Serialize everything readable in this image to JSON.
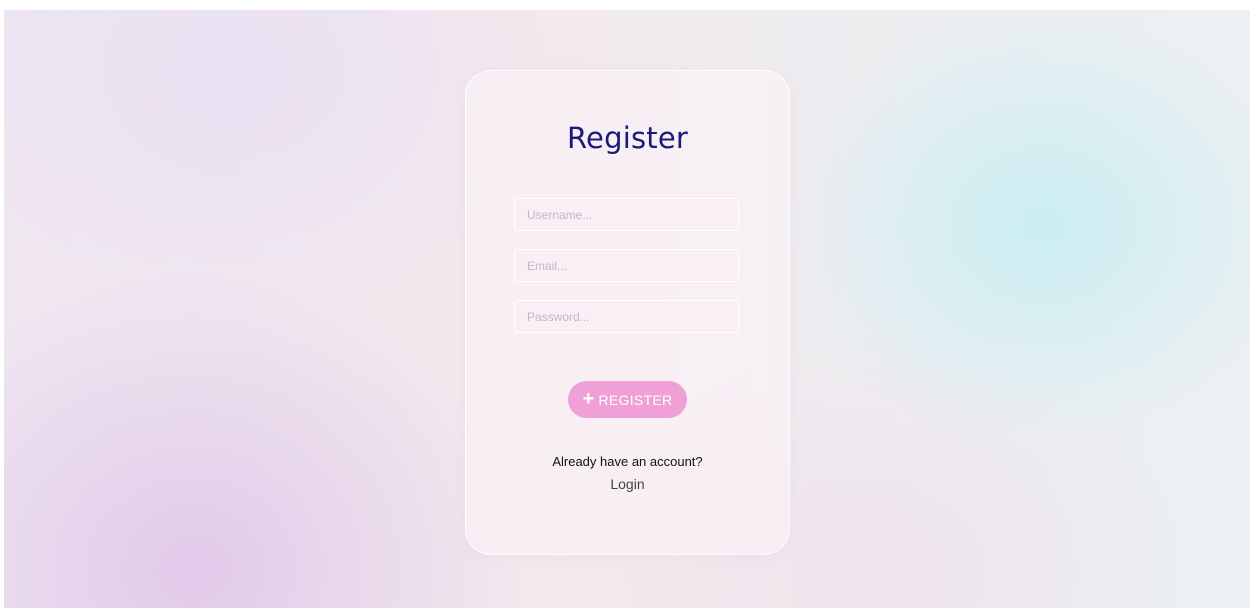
{
  "form": {
    "title": "Register",
    "username": {
      "value": "",
      "placeholder": "Username..."
    },
    "email": {
      "value": "",
      "placeholder": "Email..."
    },
    "password": {
      "value": "",
      "placeholder": "Password..."
    },
    "submit": {
      "icon": "plus-icon",
      "label": "REGISTER"
    }
  },
  "footer": {
    "question": "Already have an account?",
    "login_label": "Login"
  },
  "colors": {
    "title": "#1b1a7a",
    "button": "#eea0d7",
    "button_text": "#ffffff"
  }
}
